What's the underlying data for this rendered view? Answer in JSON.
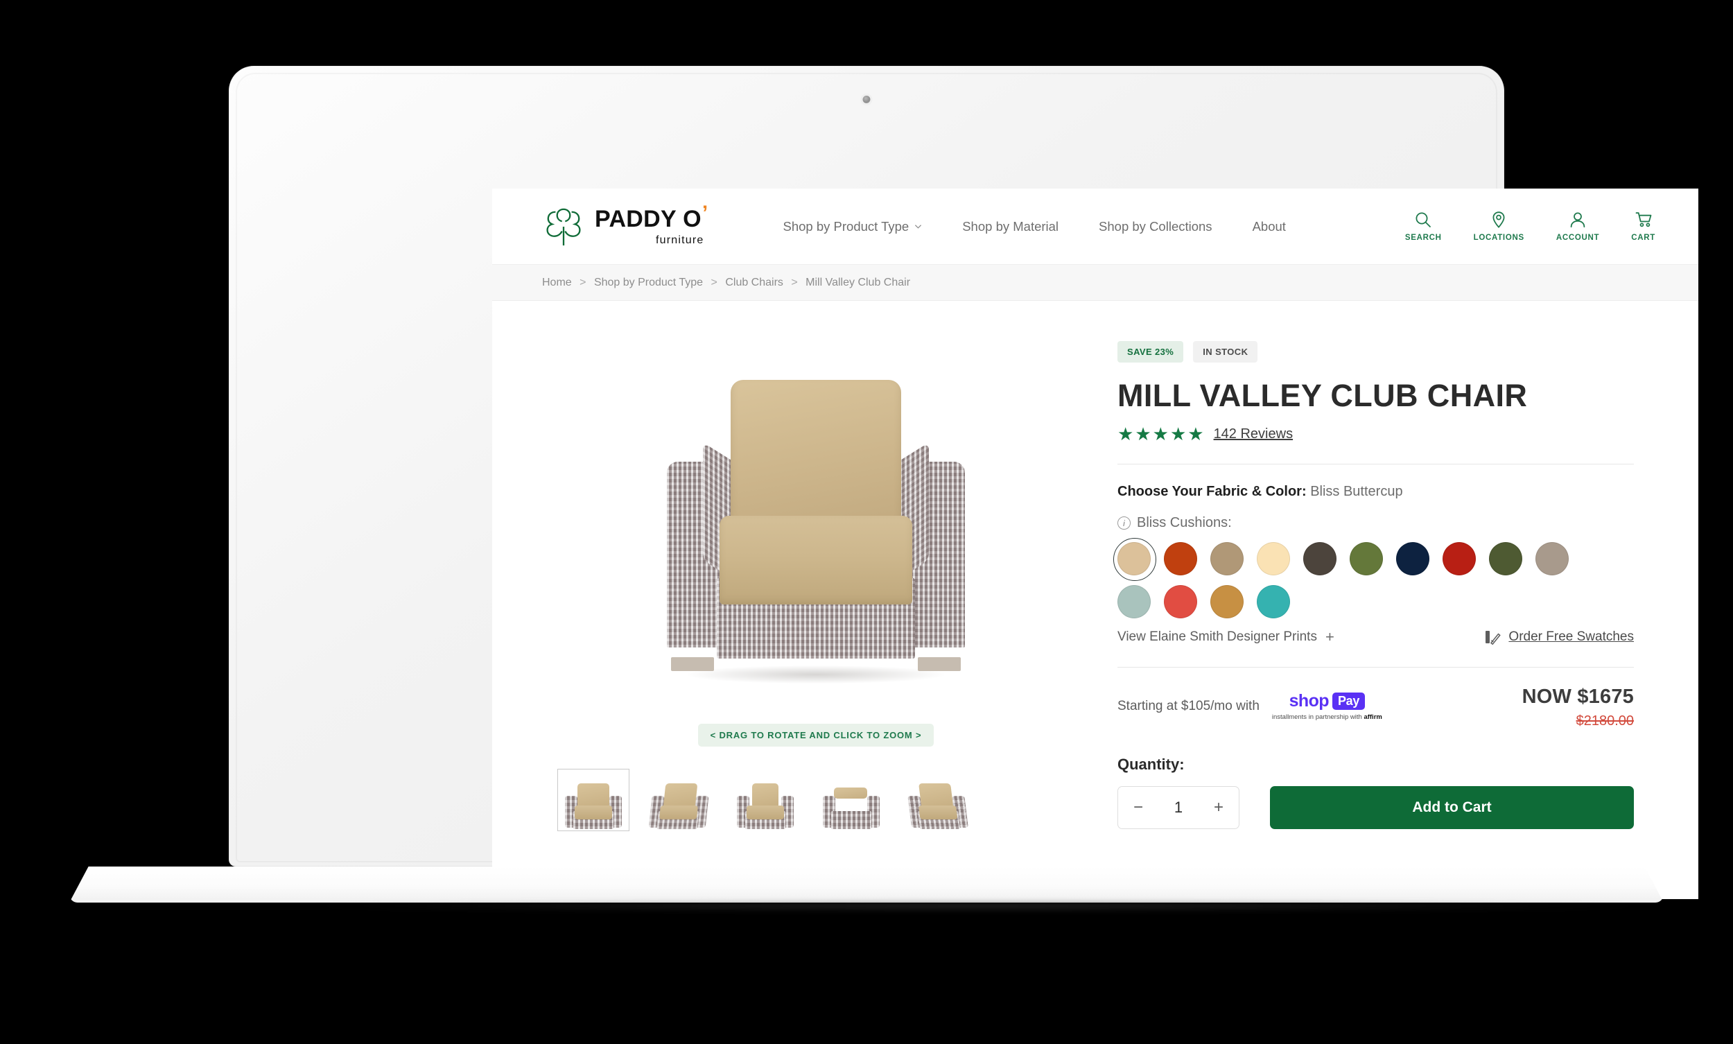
{
  "brand": {
    "name": "PADDY O",
    "apostrophe": "’",
    "sub": "furniture",
    "logo_icon": "shamrock-icon",
    "logo_color": "#0f6b37",
    "apostrophe_color": "#ef8522"
  },
  "nav": {
    "items": [
      {
        "label": "Shop by Product Type",
        "has_chevron": true
      },
      {
        "label": "Shop by Material",
        "has_chevron": false
      },
      {
        "label": "Shop by Collections",
        "has_chevron": false
      },
      {
        "label": "About",
        "has_chevron": false
      }
    ]
  },
  "header_actions": [
    {
      "label": "SEARCH",
      "icon": "search-icon"
    },
    {
      "label": "LOCATIONS",
      "icon": "location-pin-icon"
    },
    {
      "label": "ACCOUNT",
      "icon": "user-icon"
    },
    {
      "label": "CART",
      "icon": "cart-icon"
    }
  ],
  "breadcrumb": {
    "items": [
      "Home",
      "Shop by Product Type",
      "Club Chairs",
      "Mill Valley Club Chair"
    ],
    "separator": ">"
  },
  "gallery": {
    "rotate_hint": "< DRAG TO ROTATE AND CLICK TO ZOOM >",
    "thumb_count": 5,
    "selected_thumb_index": 0
  },
  "product": {
    "badges": [
      {
        "text": "SAVE 23%",
        "type": "save"
      },
      {
        "text": "IN STOCK",
        "type": "stock"
      }
    ],
    "title": "MILL VALLEY CLUB CHAIR",
    "rating_stars": 5,
    "reviews_label": "142 Reviews",
    "fabric_label": "Choose Your Fabric & Color:",
    "fabric_value": "Bliss Buttercup",
    "cushion_group_label": "Bliss Cushions:",
    "swatch_rows": [
      [
        {
          "name": "Bliss Buttercup",
          "hex": "#dcc19a",
          "selected": true
        },
        {
          "name": "Rust",
          "hex": "#c0400f"
        },
        {
          "name": "Khaki",
          "hex": "#b09877"
        },
        {
          "name": "Cream",
          "hex": "#fae2b4"
        },
        {
          "name": "Dark Brown",
          "hex": "#4c443c"
        },
        {
          "name": "Olive",
          "hex": "#64783a"
        },
        {
          "name": "Navy",
          "hex": "#0d2240"
        },
        {
          "name": "Red",
          "hex": "#b81f14"
        },
        {
          "name": "Forest Olive",
          "hex": "#4e5a32"
        },
        {
          "name": "Warm Grey",
          "hex": "#a89a8c"
        }
      ],
      [
        {
          "name": "Sage",
          "hex": "#a9c3bd"
        },
        {
          "name": "Coral",
          "hex": "#e14d42"
        },
        {
          "name": "Ochre",
          "hex": "#c79043"
        },
        {
          "name": "Teal",
          "hex": "#35b2b0"
        }
      ]
    ],
    "prints_link": "View Elaine Smith Designer Prints",
    "prints_plus": "+",
    "swatch_order_label": "Order Free Swatches",
    "swatch_order_icon": "swatch-fan-icon",
    "financing_text": "Starting at $105/mo with",
    "shoppay_word": "shop",
    "shoppay_pay": "Pay",
    "shoppay_note_prefix": "installments in partnership with ",
    "shoppay_note_brand": "affirm",
    "price_now": "NOW $1675",
    "price_was": "$2180.00",
    "quantity_label": "Quantity:",
    "quantity_minus": "−",
    "quantity_value": "1",
    "quantity_plus": "+",
    "add_to_cart": "Add to Cart"
  },
  "colors": {
    "brand_green": "#0e6b37",
    "accent_orange": "#ef8522",
    "sale_red": "#d24a3c",
    "shoppay_purple": "#5a31f4"
  }
}
